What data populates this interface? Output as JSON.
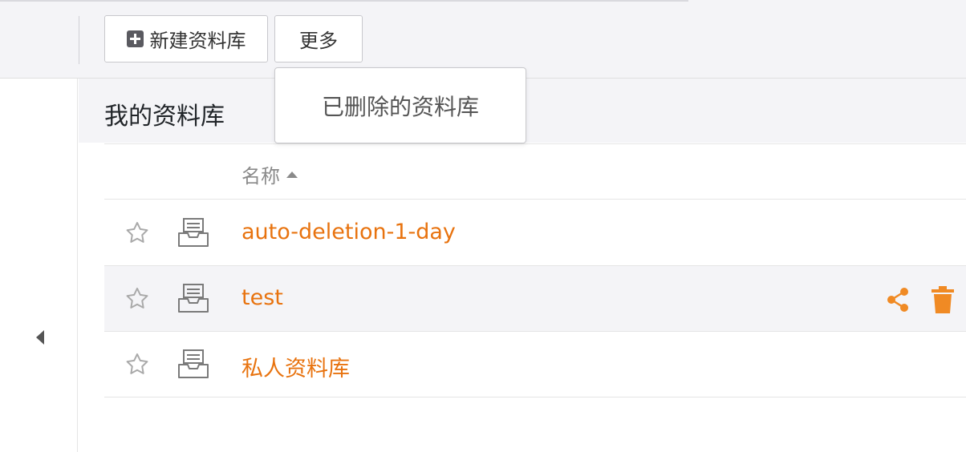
{
  "toolbar": {
    "new_library_label": "新建资料库",
    "more_label": "更多"
  },
  "more_menu": {
    "items": [
      {
        "label": "已删除的资料库"
      }
    ]
  },
  "main": {
    "title": "我的资料库"
  },
  "table": {
    "columns": {
      "name_label": "名称"
    },
    "sort": {
      "column": "名称",
      "direction": "ascending"
    },
    "rows": [
      {
        "name": "auto-deletion-1-day",
        "starred": false,
        "highlighted": false
      },
      {
        "name": "test",
        "starred": false,
        "highlighted": true
      },
      {
        "name": "私人资料库",
        "starred": false,
        "highlighted": false
      }
    ]
  },
  "icons": {
    "new": "plus-square-icon",
    "star": "star-outline-icon",
    "library": "inbox-tray-icon",
    "share": "share-icon",
    "delete": "trash-icon",
    "collapse": "caret-left-icon",
    "sort": "caret-up-icon"
  },
  "colors": {
    "accent": "#e8730f",
    "icon_accent": "#f08a24",
    "header_bg": "#f4f4f7",
    "muted_text": "#8a8a8a"
  }
}
